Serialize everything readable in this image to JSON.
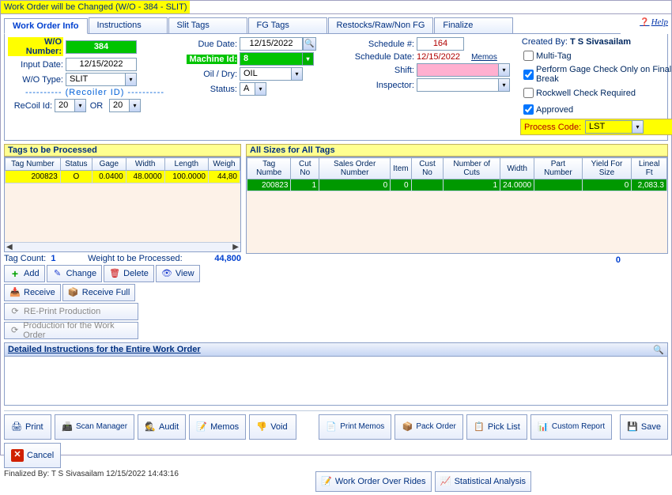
{
  "title": "Work Order will be Changed  (W/O - 384 - SLIT)",
  "help": "Help",
  "tabs": [
    "Work Order Info",
    "Instructions",
    "Slit Tags",
    "FG Tags",
    "Restocks/Raw/Non FG",
    "Finalize"
  ],
  "form": {
    "wo_number_label": "W/O Number:",
    "wo_number": "384",
    "input_date_label": "Input Date:",
    "input_date": "12/15/2022",
    "wo_type_label": "W/O Type:",
    "wo_type": "SLIT",
    "recoiler_label": "(Recoiler ID)",
    "recoil_id_label": "ReCoil Id:",
    "recoil_a": "20",
    "or": "OR",
    "recoil_b": "20",
    "due_date_label": "Due Date:",
    "due_date": "12/15/2022",
    "machine_id_label": "Machine Id:",
    "machine_id": "8",
    "oil_dry_label": "Oil / Dry:",
    "oil_dry": "OIL",
    "status_label": "Status:",
    "status": "A",
    "schedule_no_label": "Schedule #:",
    "schedule_no": "164",
    "schedule_date_label": "Schedule Date:",
    "schedule_date": "12/15/2022",
    "memos_link": "Memos",
    "shift_label": "Shift:",
    "inspector_label": "Inspector:",
    "created_by_label": "Created By:",
    "created_by": "T S Sivasailam",
    "multi_tag": "Multi-Tag",
    "gage_check": "Perform Gage Check Only on Final Break",
    "rockwell": "Rockwell Check Required",
    "approved": "Approved",
    "process_code_label": "Process Code:",
    "process_code": "LST"
  },
  "left_panel": {
    "title": "Tags to be Processed",
    "cols": [
      "Tag Number",
      "Status",
      "Gage",
      "Width",
      "Length",
      "Weigh"
    ],
    "row": {
      "tag": "200823",
      "status": "O",
      "gage": "0.0400",
      "width": "48.0000",
      "length": "100.0000",
      "weight": "44,80"
    },
    "tag_count_label": "Tag Count:",
    "tag_count": "1",
    "weight_label": "Weight to be Processed:",
    "weight": "44,800",
    "btn_add": "Add",
    "btn_change": "Change",
    "btn_delete": "Delete",
    "btn_view": "View",
    "btn_receive": "Receive",
    "btn_receive_full": "Receive Full",
    "btn_reprint": "RE-Print Production",
    "btn_prod": "Production for the Work Order"
  },
  "right_panel": {
    "title": "All Sizes for All Tags",
    "cols": [
      "Tag Numbe",
      "Cut No",
      "Sales Order Number",
      "Item",
      "Cust No",
      "Number of Cuts",
      "Width",
      "Part Number",
      "Yield For Size",
      "Lineal Ft"
    ],
    "row": {
      "tag": "200823",
      "cutno": "1",
      "so": "0",
      "item": "0",
      "cust": "",
      "cuts": "1",
      "width": "24.0000",
      "part": "",
      "yield": "0",
      "lineal": "2,083.3"
    },
    "bottom_total": "0"
  },
  "detail_title": "Detailed Instructions for the Entire Work Order",
  "footer": {
    "print": "Print",
    "scan": "Scan Manager",
    "audit": "Audit",
    "memos": "Memos",
    "void": "Void",
    "print_memos": "Print Memos",
    "pack": "Pack Order",
    "pick": "Pick List",
    "custom": "Custom Report",
    "save": "Save",
    "cancel": "Cancel",
    "overrides": "Work Order Over Rides",
    "stat": "Statistical Analysis"
  },
  "finalized": "Finalized By: T S Sivasailam 12/15/2022 14:43:16"
}
